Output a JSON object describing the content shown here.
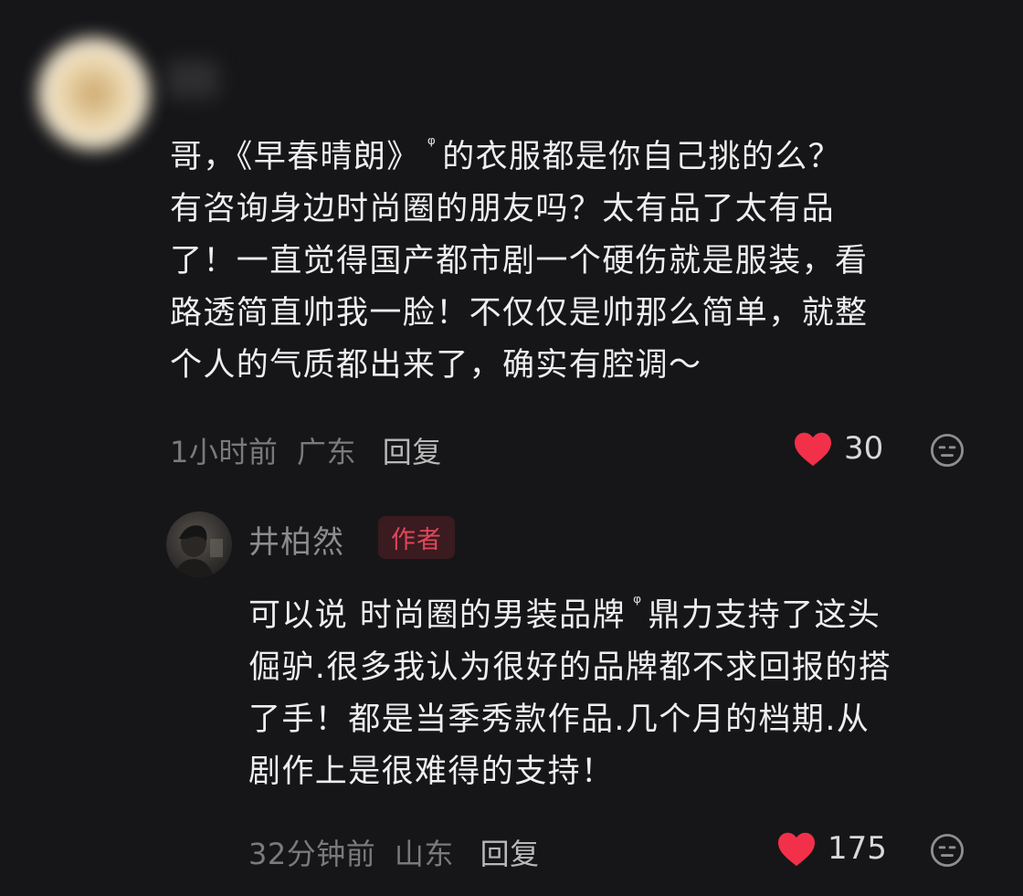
{
  "comment1": {
    "text_part1": "哥，《早春晴朗》",
    "text_part2": "的衣服都是你自己挑的么？\n有咨询身边时尚圈的朋友吗？太有品了太有品\n了！一直觉得国产都市剧一个硬伤就是服装，看\n路透简直帅我一脸！不仅仅是帅那么简单，就整\n个人的气质都出来了，确实有腔调～",
    "time": "1小时前",
    "location": "广东",
    "reply": "回复",
    "likes": "30"
  },
  "comment2": {
    "author": "井柏然",
    "badge": "作者",
    "text_part1": "可以说 时尚圈的男装品牌",
    "text_part2": "鼎力支持了这头\n倔驴.很多我认为很好的品牌都不求回报的搭\n了手！都是当季秀款作品.几个月的档期.从\n剧作上是很难得的支持！",
    "time": "32分钟前",
    "location": "山东",
    "reply": "回复",
    "likes": "175"
  },
  "icons": {
    "search_link": "search-icon",
    "like": "heart-icon",
    "dislike": "dislike-face-icon"
  },
  "colors": {
    "background": "#161619",
    "heart": "#f2304a",
    "badge_text": "#e0475b"
  }
}
